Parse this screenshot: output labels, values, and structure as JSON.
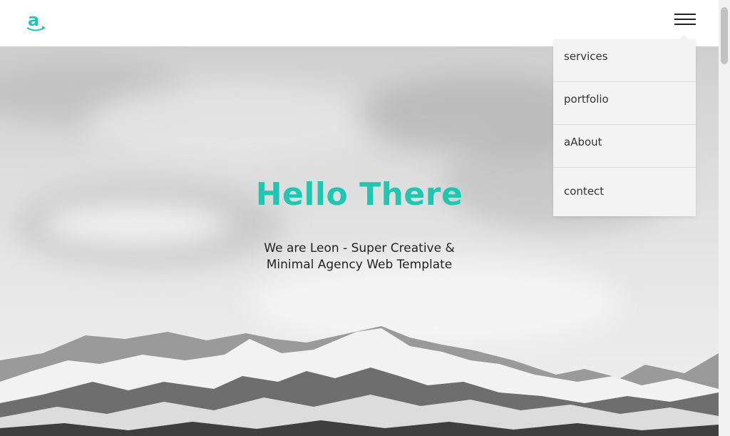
{
  "brand": {
    "logo_letter": "a",
    "accent_color": "#1fc7b3"
  },
  "menu": {
    "icon": "hamburger-menu-icon",
    "items": [
      {
        "label": "services"
      },
      {
        "label": "portfolio"
      },
      {
        "label": "aAbout"
      },
      {
        "label": "contect"
      }
    ]
  },
  "hero": {
    "title": "Hello There",
    "subtitle_line1": "We are Leon - Super Creative &",
    "subtitle_line2": "Minimal Agency Web Template"
  }
}
